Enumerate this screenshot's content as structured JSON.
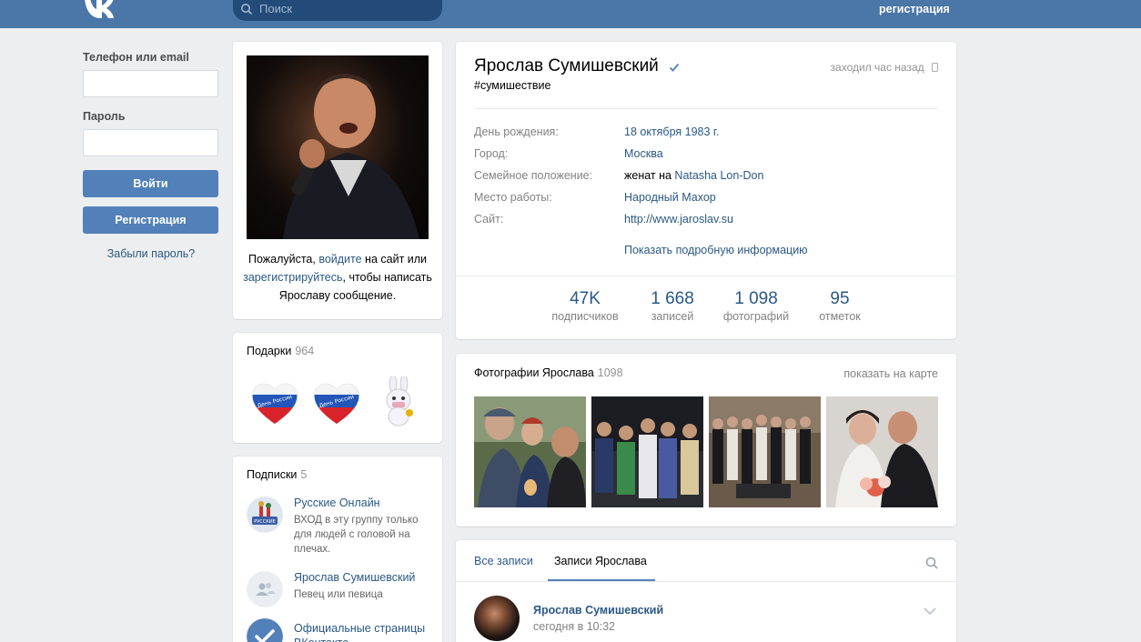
{
  "header": {
    "search_placeholder": "Поиск",
    "register_link": "регистрация"
  },
  "login": {
    "phone_label": "Телефон или email",
    "password_label": "Пароль",
    "login_button": "Войти",
    "register_button": "Регистрация",
    "forgot_link": "Забыли пароль?"
  },
  "avatar_card": {
    "msg_before": "Пожалуйста, ",
    "login_link": "войдите",
    "msg_middle": " на сайт или ",
    "register_link": "зарегистрируйтесь",
    "msg_after": ", чтобы написать Ярославу сообщение."
  },
  "gifts": {
    "title": "Подарки",
    "count": "964",
    "items": [
      "heart-russia-gift",
      "heart-russia-gift",
      "bunny-gift"
    ]
  },
  "subscriptions": {
    "title": "Подписки",
    "count": "5",
    "items": [
      {
        "name": "Русские Онлайн",
        "desc": "ВХОД в эту группу только для людей с головой на плечах.",
        "icon": "group-logo"
      },
      {
        "name": "Ярослав Сумишевский",
        "desc": "Певец или певица",
        "icon": "people-icon"
      },
      {
        "name": "Официальные страницы ВКонтакте",
        "desc": "",
        "icon": "checkmark-icon"
      }
    ]
  },
  "profile": {
    "name": "Ярослав Сумишевский",
    "status": "#сумишествие",
    "online": "заходил час назад",
    "info": [
      {
        "key": "День рождения:",
        "value": "18 октября 1983 г.",
        "link": true
      },
      {
        "key": "Город:",
        "value": "Москва",
        "link": true
      },
      {
        "key": "Семейное положение:",
        "value_prefix": "женат на ",
        "value": "Natasha Lon-Don",
        "link": true
      },
      {
        "key": "Место работы:",
        "value": "Народный Махор",
        "link": true
      },
      {
        "key": "Сайт:",
        "value": "http://www.jaroslav.su",
        "link": true
      }
    ],
    "show_more": "Показать подробную информацию",
    "counters": [
      {
        "num": "47K",
        "label": "подписчиков"
      },
      {
        "num": "1 668",
        "label": "записей"
      },
      {
        "num": "1 098",
        "label": "фотографий"
      },
      {
        "num": "95",
        "label": "отметок"
      }
    ]
  },
  "photos": {
    "title": "Фотографии Ярослава",
    "count": "1098",
    "map_link": "показать на карте"
  },
  "wall": {
    "tabs": [
      "Все записи",
      "Записи Ярослава"
    ],
    "post_author": "Ярослав Сумишевский",
    "post_time": "сегодня в 10:32"
  },
  "colors": {
    "header": "#4a76a8",
    "accent": "#5181b8",
    "link": "#2a5885",
    "background": "#edeef0"
  }
}
